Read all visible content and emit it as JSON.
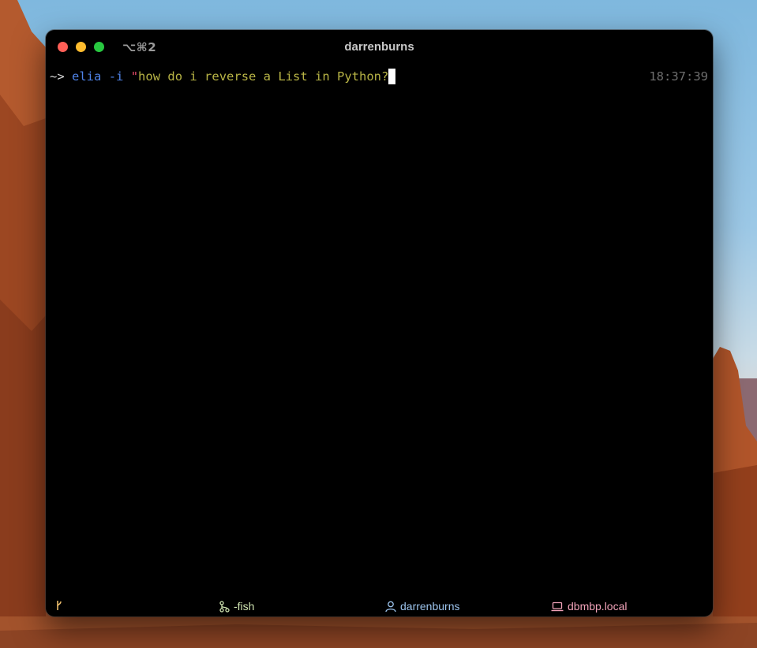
{
  "window": {
    "title": "darrenburns",
    "tab_shortcut": "⌥⌘2"
  },
  "terminal": {
    "prompt_symbol": "~>",
    "command": "elia",
    "flag": "-i",
    "quote_mark": "\"",
    "argument_text": "how do i reverse a List in Python?",
    "timestamp": "18:37:39"
  },
  "statusbar": {
    "shell_label": "-fish",
    "user_label": "darrenburns",
    "host_label": "dbmbp.local"
  },
  "colors": {
    "close": "#ff5f57",
    "minimize": "#febc2e",
    "maximize": "#28c840",
    "command": "#4f83e8",
    "argument": "#b9b546",
    "timestamp": "#6e6e6e"
  },
  "icons": {
    "branch": "git-branch-icon",
    "shell": "git-fork-icon",
    "user": "person-icon",
    "host": "laptop-icon"
  }
}
